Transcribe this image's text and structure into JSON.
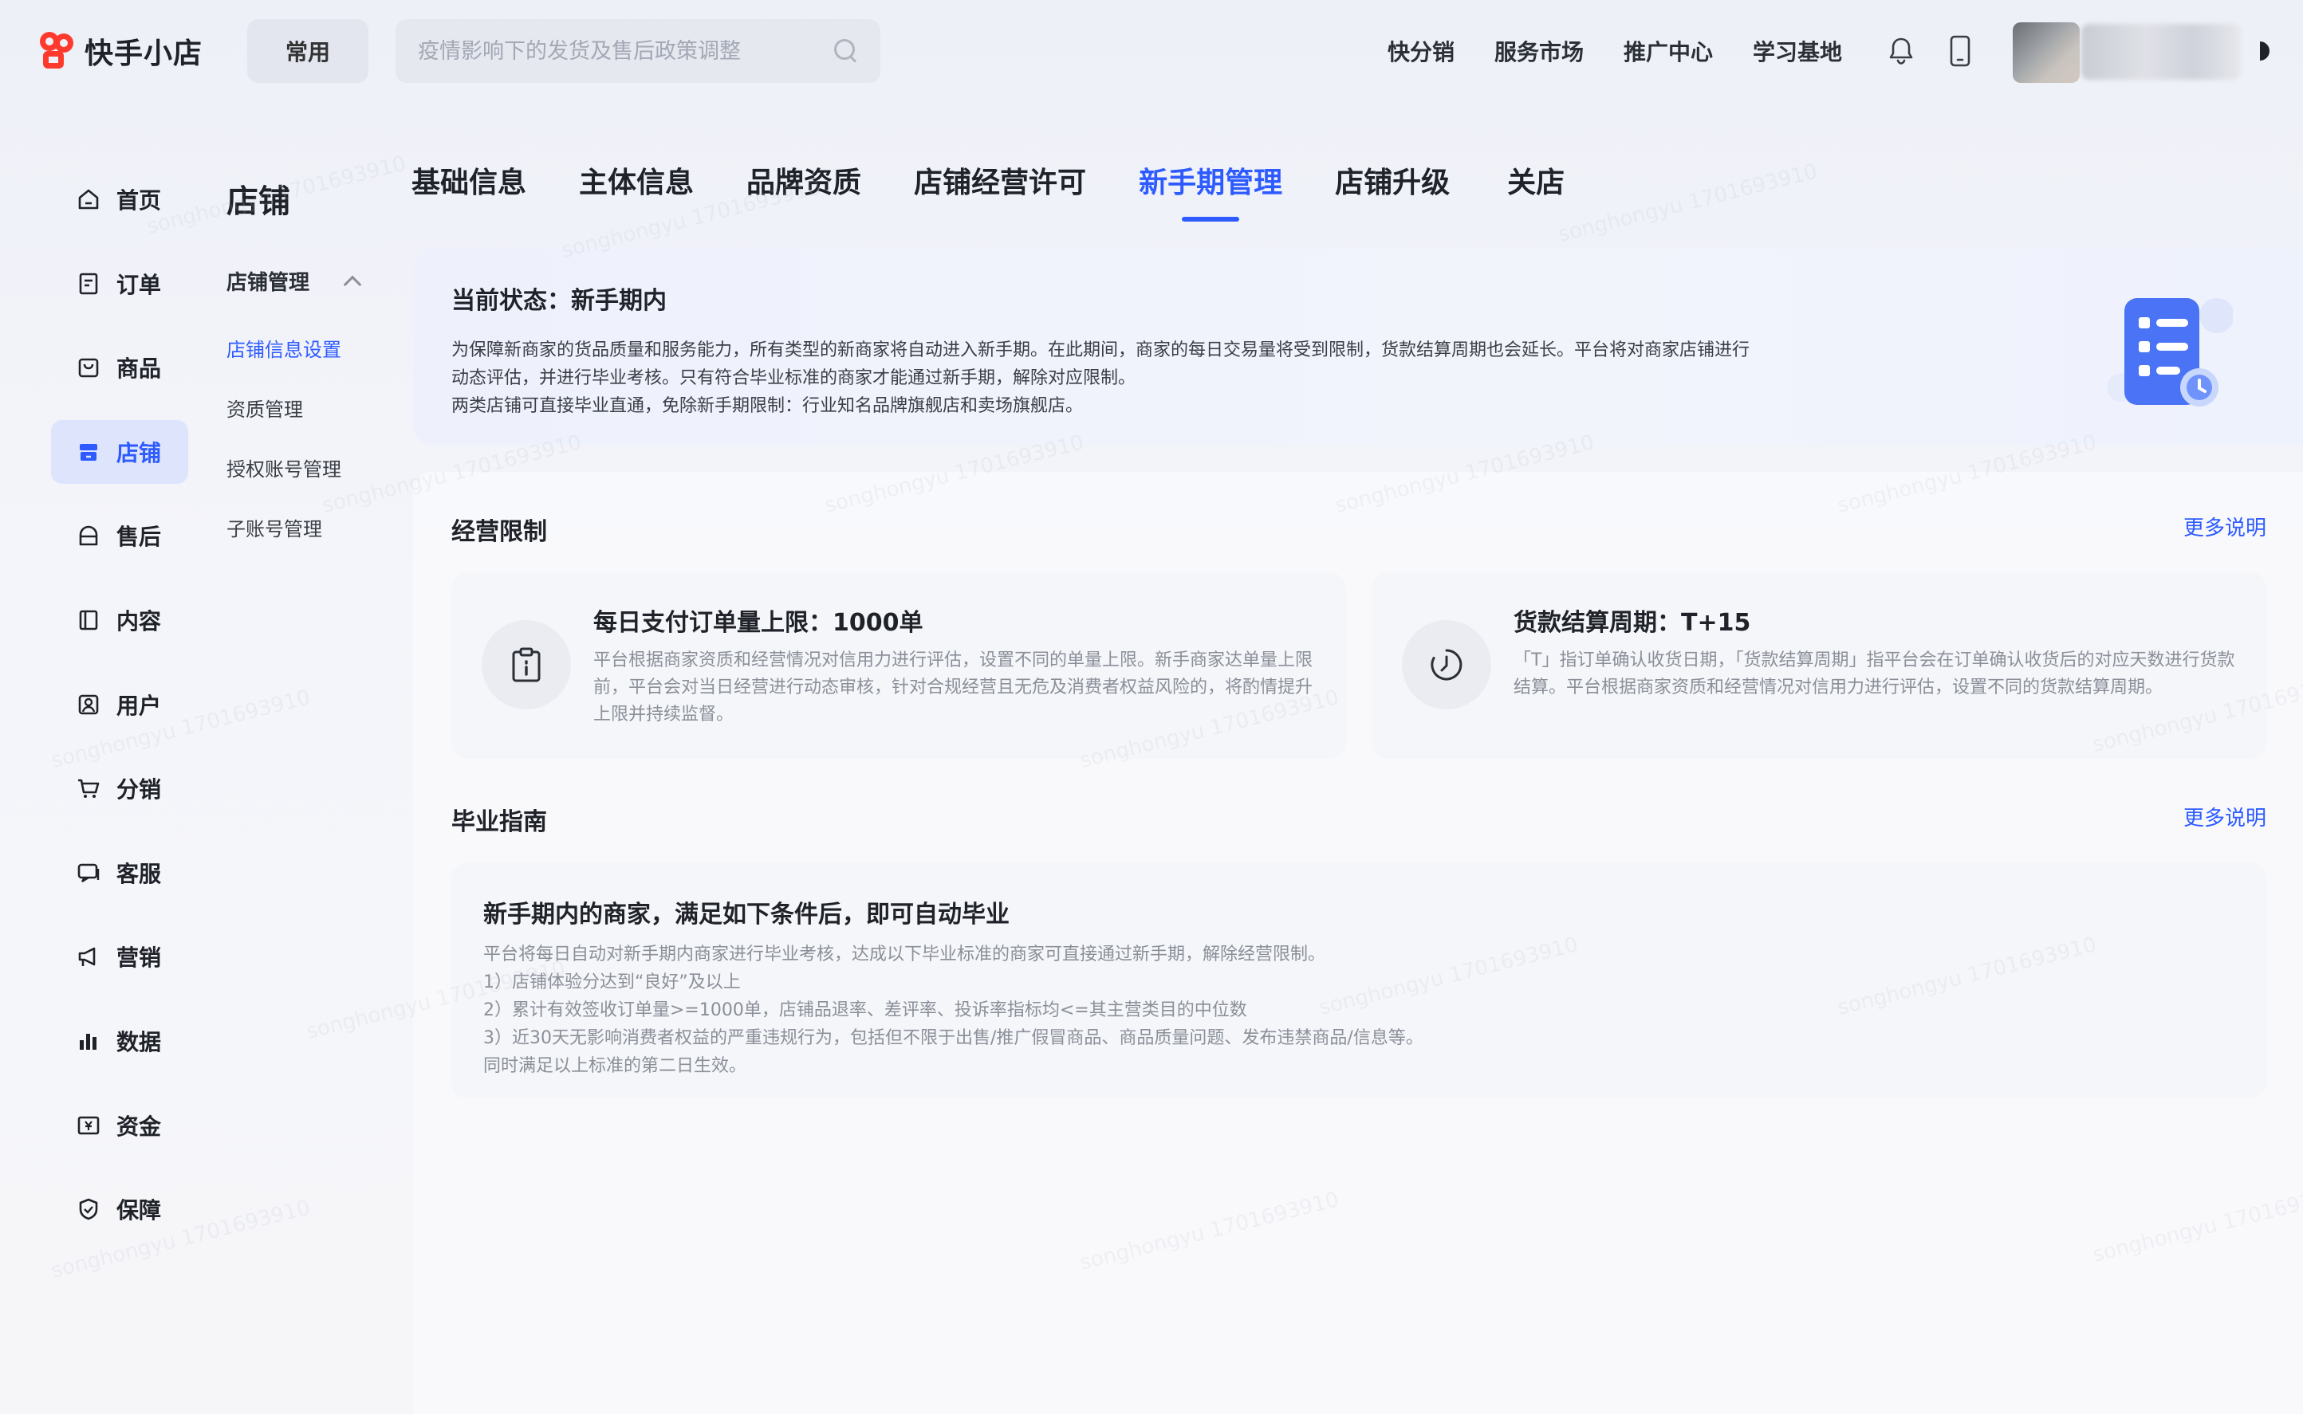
{
  "header": {
    "logo_text": "快手小店",
    "common_label": "常用",
    "search_placeholder": "疫情影响下的发货及售后政策调整",
    "nav": [
      "快分销",
      "服务市场",
      "推广中心",
      "学习基地"
    ]
  },
  "sidebar": {
    "items": [
      {
        "label": "首页",
        "icon": "home-icon"
      },
      {
        "label": "订单",
        "icon": "order-icon"
      },
      {
        "label": "商品",
        "icon": "product-icon"
      },
      {
        "label": "店铺",
        "icon": "store-icon",
        "active": true
      },
      {
        "label": "售后",
        "icon": "after-sale-icon"
      },
      {
        "label": "内容",
        "icon": "content-icon"
      },
      {
        "label": "用户",
        "icon": "user-icon"
      },
      {
        "label": "分销",
        "icon": "cart-icon"
      },
      {
        "label": "客服",
        "icon": "service-icon"
      },
      {
        "label": "营销",
        "icon": "megaphone-icon"
      },
      {
        "label": "数据",
        "icon": "bar-chart-icon"
      },
      {
        "label": "资金",
        "icon": "wallet-icon"
      },
      {
        "label": "保障",
        "icon": "shield-icon"
      }
    ]
  },
  "subnav": {
    "title": "店铺",
    "group_label": "店铺管理",
    "items": [
      "店铺信息设置",
      "资质管理",
      "授权账号管理",
      "子账号管理"
    ]
  },
  "tabs": [
    "基础信息",
    "主体信息",
    "品牌资质",
    "店铺经营许可",
    "新手期管理",
    "店铺升级",
    "关店"
  ],
  "active_tab": 4,
  "status": {
    "title": "当前状态：新手期内",
    "lines": [
      "为保障新商家的货品质量和服务能力，所有类型的新商家将自动进入新手期。在此期间，商家的每日交易量将受到限制，货款结算周期也会延长。平台将对商家店铺进行",
      "动态评估，并进行毕业考核。只有符合毕业标准的商家才能通过新手期，解除对应限制。",
      "两类店铺可直接毕业直通，免除新手期限制：行业知名品牌旗舰店和卖场旗舰店。"
    ]
  },
  "limits": {
    "title": "经营限制",
    "more": "更多说明",
    "cards": [
      {
        "icon": "clipboard-icon",
        "title": "每日支付订单量上限：1000单",
        "desc": "平台根据商家资质和经营情况对信用力进行评估，设置不同的单量上限。新手商家达单量上限前，平台会对当日经营进行动态审核，针对合规经营且无危及消费者权益风险的，将酌情提升上限并持续监督。"
      },
      {
        "icon": "clock-icon",
        "title": "货款结算周期：T+15",
        "desc": "「T」指订单确认收货日期，「货款结算周期」指平台会在订单确认收货后的对应天数进行货款结算。平台根据商家资质和经营情况对信用力进行评估，设置不同的货款结算周期。"
      }
    ]
  },
  "guide": {
    "title": "毕业指南",
    "more": "更多说明",
    "card_title": "新手期内的商家，满足如下条件后，即可自动毕业",
    "lines": [
      "平台将每日自动对新手期内商家进行毕业考核，达成以下毕业标准的商家可直接通过新手期，解除经营限制。",
      "1）店铺体验分达到“良好”及以上",
      "2）累计有效签收订单量>=1000单，店铺品退率、差评率、投诉率指标均<=其主营类目的中位数",
      "3）近30天无影响消费者权益的严重违规行为，包括但不限于出售/推广假冒商品、商品质量问题、发布违禁商品/信息等。",
      "同时满足以上标准的第二日生效。"
    ]
  },
  "watermark": "songhongyu 1701693910",
  "colors": {
    "accent": "#2d5bff",
    "brand": "#fe3a2d"
  }
}
